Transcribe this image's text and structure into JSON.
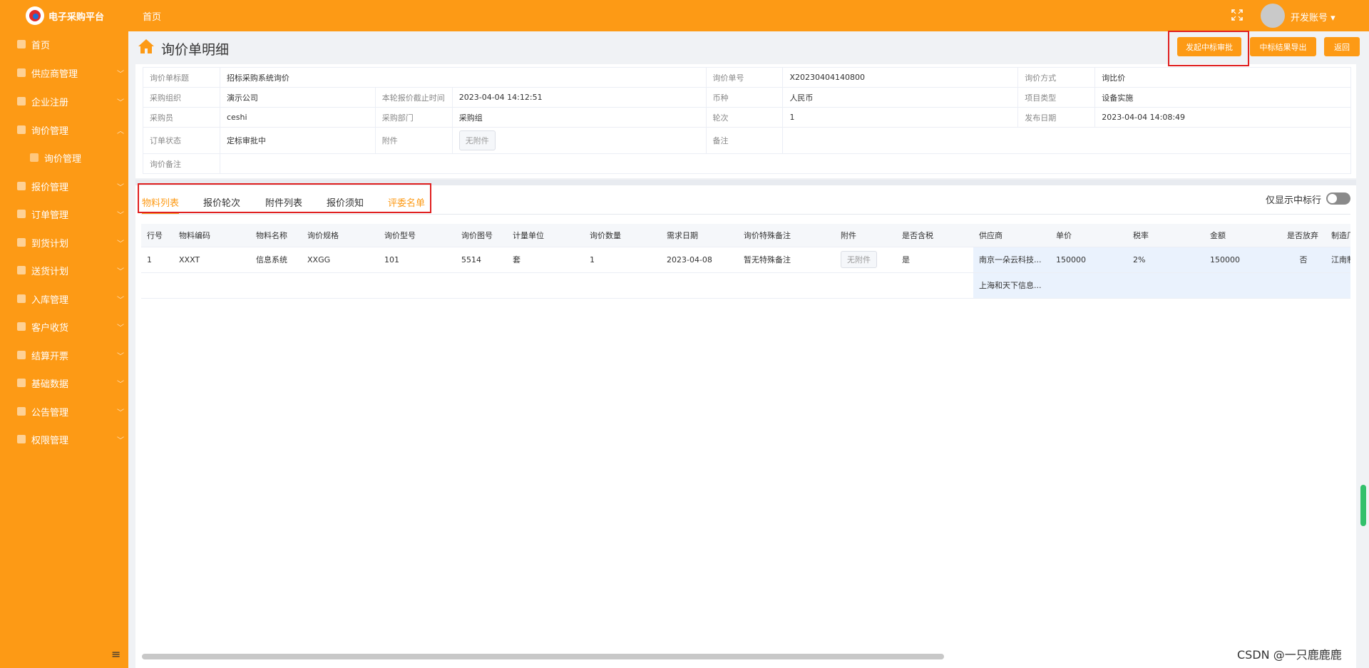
{
  "app": {
    "logo_text": "电子采购平台",
    "breadcrumb": "首页",
    "account": "开发账号 ▾"
  },
  "sidebar": {
    "items": [
      {
        "label": "首页",
        "icon": "home-icon"
      },
      {
        "label": "供应商管理",
        "icon": "user-icon"
      },
      {
        "label": "企业注册",
        "icon": "user-icon"
      },
      {
        "label": "询价管理",
        "icon": "flag-icon"
      },
      {
        "label": "询价管理",
        "icon": "list-icon"
      },
      {
        "label": "报价管理",
        "icon": "copy-icon"
      },
      {
        "label": "订单管理",
        "icon": "calendar-icon"
      },
      {
        "label": "到货计划",
        "icon": "cart-icon"
      },
      {
        "label": "送货计划",
        "icon": "truck-icon"
      },
      {
        "label": "入库管理",
        "icon": "calendar-icon"
      },
      {
        "label": "客户收货",
        "icon": "edit-icon"
      },
      {
        "label": "结算开票",
        "icon": "print-icon"
      },
      {
        "label": "基础数据",
        "icon": "folder-icon"
      },
      {
        "label": "公告管理",
        "icon": "notice-icon"
      },
      {
        "label": "权限管理",
        "icon": "gear-icon"
      }
    ],
    "collapse": "≡"
  },
  "header": {
    "title": "询价单明细",
    "buttons": {
      "approve": "发起中标审批",
      "export": "中标结果导出",
      "back": "返回"
    }
  },
  "info": {
    "r1": [
      "询价单标题",
      "招标采购系统询价",
      "询价单号",
      "X20230404140800",
      "询价方式",
      "询比价"
    ],
    "r2": [
      "采购组织",
      "演示公司",
      "本轮报价截止时间",
      "2023-04-04 14:12:51",
      "币种",
      "人民币",
      "项目类型",
      "设备实施"
    ],
    "r3": [
      "采购员",
      "ceshi",
      "采购部门",
      "采购组",
      "轮次",
      "1",
      "发布日期",
      "2023-04-04 14:08:49"
    ],
    "r4": [
      "订单状态",
      "定标审批中",
      "附件",
      "无附件",
      "备注"
    ],
    "r5": [
      "询价备注"
    ]
  },
  "tabs": [
    "物料列表",
    "报价轮次",
    "附件列表",
    "报价须知",
    "评委名单"
  ],
  "filter": {
    "label": "仅显示中标行"
  },
  "table": {
    "headers": [
      "行号",
      "物料编码",
      "物料名称",
      "询价规格",
      "询价型号",
      "询价图号",
      "计量单位",
      "询价数量",
      "需求日期",
      "询价特殊备注",
      "附件",
      "是否含税",
      "供应商",
      "单价",
      "税率",
      "金额",
      "是否放弃",
      "制造厂"
    ],
    "row": [
      "1",
      "XXXT",
      "信息系统",
      "XXGG",
      "101",
      "5514",
      "套",
      "1",
      "2023-04-08",
      "暂无特殊备注",
      "无附件",
      "是",
      "南京一朵云科技...",
      "150000",
      "2%",
      "150000",
      "否",
      "江南制"
    ],
    "supplier2": "上海和天下信息..."
  },
  "watermark": "CSDN @一只鹿鹿鹿",
  "colors": {
    "accent": "#fd9a15",
    "highlight_box": "#e02020",
    "supplier_cell": "#eaf2fd"
  }
}
